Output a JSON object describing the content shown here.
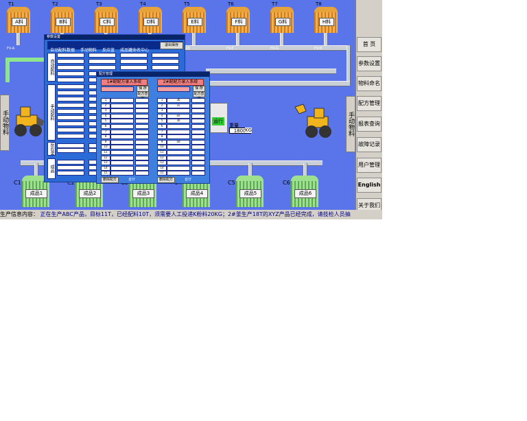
{
  "tanks": [
    {
      "id": "T1",
      "label": "A料",
      "valve": "FV-A"
    },
    {
      "id": "T2",
      "label": "B料",
      "valve": ""
    },
    {
      "id": "T3",
      "label": "C料",
      "valve": ""
    },
    {
      "id": "T4",
      "label": "D料",
      "valve": ""
    },
    {
      "id": "T5",
      "label": "E料",
      "valve": "FV-E"
    },
    {
      "id": "T6",
      "label": "F料",
      "valve": "FV-F"
    },
    {
      "id": "T7",
      "label": "G料",
      "valve": "FV-G"
    },
    {
      "id": "T8",
      "label": "H料",
      "valve": "FV-H"
    }
  ],
  "products": [
    {
      "id": "C1",
      "label": "成品1"
    },
    {
      "id": "C2",
      "label": "成品2"
    },
    {
      "id": "C3",
      "label": "成品3"
    },
    {
      "id": "C4",
      "label": "成品4"
    },
    {
      "id": "C5",
      "label": "成品5"
    },
    {
      "id": "C6",
      "label": "成品6"
    }
  ],
  "manual_label_left": "手动物料",
  "manual_label_right": "手动物料",
  "mixer": {
    "weight_label": "重量",
    "weight_value": "18000",
    "unit": "KG",
    "status": "运行"
  },
  "nav": [
    {
      "label": "首 页"
    },
    {
      "label": "参数设置"
    },
    {
      "label": "物料命名"
    },
    {
      "label": "配方管理"
    },
    {
      "label": "报表查询"
    },
    {
      "label": "故障记录"
    },
    {
      "label": "用户管理"
    },
    {
      "label": "English"
    },
    {
      "label": "关于我们"
    }
  ],
  "status_bar": {
    "label": "生产信息内容：",
    "message": "正在生产ABC产品，目标11T，已经配料10T，须需要人工投递K粉料20KG；2#釜生产18T的XYZ产品已经完成，请技检人员抽"
  },
  "dialog1": {
    "title": "参数设置",
    "tabs": [
      "自动配料数据",
      "手动物料",
      "反应釜",
      "成品罐命名中心"
    ],
    "close": "退出保存",
    "sections": [
      "自动配料",
      "手动配料",
      "反应釜",
      "成品"
    ]
  },
  "dialog2": {
    "title": "配方管理",
    "left_header": "1#配配方录入系统",
    "right_header": "2#配配方录入系统",
    "btn_save": "保 存",
    "btn_query": "配方查询",
    "btn_delete": "删除配方",
    "row_numbers": [
      "1",
      "2",
      "3",
      "4",
      "5",
      "6",
      "7",
      "8",
      "9",
      "10",
      "11",
      "12",
      "13",
      "14",
      "15"
    ],
    "right_values": [
      "36",
      "vv",
      "",
      "ee",
      "36",
      "",
      "",
      "",
      "dd",
      "",
      "",
      "",
      "",
      "",
      ""
    ],
    "footer": "合计"
  },
  "colors": {
    "background": "#5a74ea",
    "tank": "#e8a23a",
    "silo": "#9fe08f",
    "dialog": "#2a6bd8",
    "header": "#f08080"
  }
}
